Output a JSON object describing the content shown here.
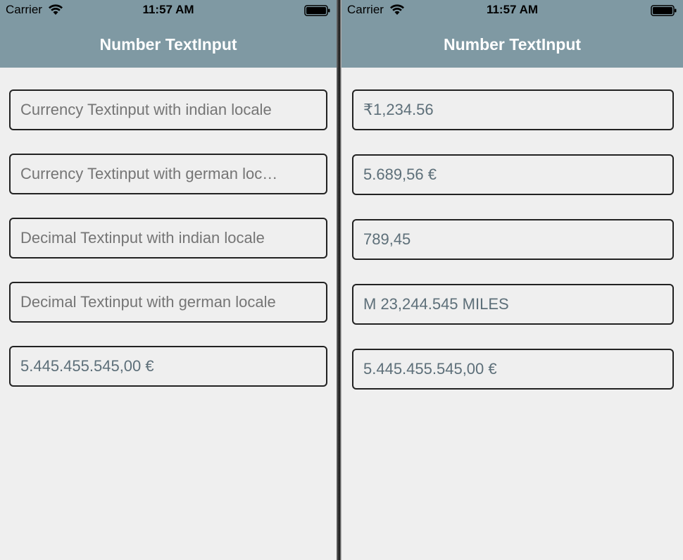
{
  "left_screen": {
    "status": {
      "carrier": "Carrier",
      "time": "11:57 AM",
      "icons": [
        "wifi-icon",
        "battery-icon"
      ]
    },
    "header": {
      "title": "Number TextInput"
    },
    "fields": [
      {
        "placeholder": "Currency Textinput with indian locale",
        "value": ""
      },
      {
        "placeholder": "Currency Textinput with german loc…",
        "value": ""
      },
      {
        "placeholder": "Decimal Textinput with indian locale",
        "value": ""
      },
      {
        "placeholder": "Decimal Textinput with german locale",
        "value": ""
      },
      {
        "placeholder": "",
        "value": "5.445.455.545,00 €"
      }
    ]
  },
  "right_screen": {
    "status": {
      "carrier": "Carrier",
      "time": "11:57 AM",
      "icons": [
        "wifi-icon",
        "battery-icon"
      ]
    },
    "header": {
      "title": "Number TextInput"
    },
    "fields": [
      {
        "value": "₹1,234.56"
      },
      {
        "value": "5.689,56 €"
      },
      {
        "value": "789,45"
      },
      {
        "value": "M 23,244.545 MILES"
      },
      {
        "value": "5.445.455.545,00 €"
      }
    ]
  },
  "colors": {
    "header_bg": "#7f99a3",
    "screen_bg": "#efefef",
    "input_border": "#222222",
    "placeholder_text": "#b8bcbf",
    "value_text": "#5d6f79",
    "title_text": "#ffffff"
  }
}
